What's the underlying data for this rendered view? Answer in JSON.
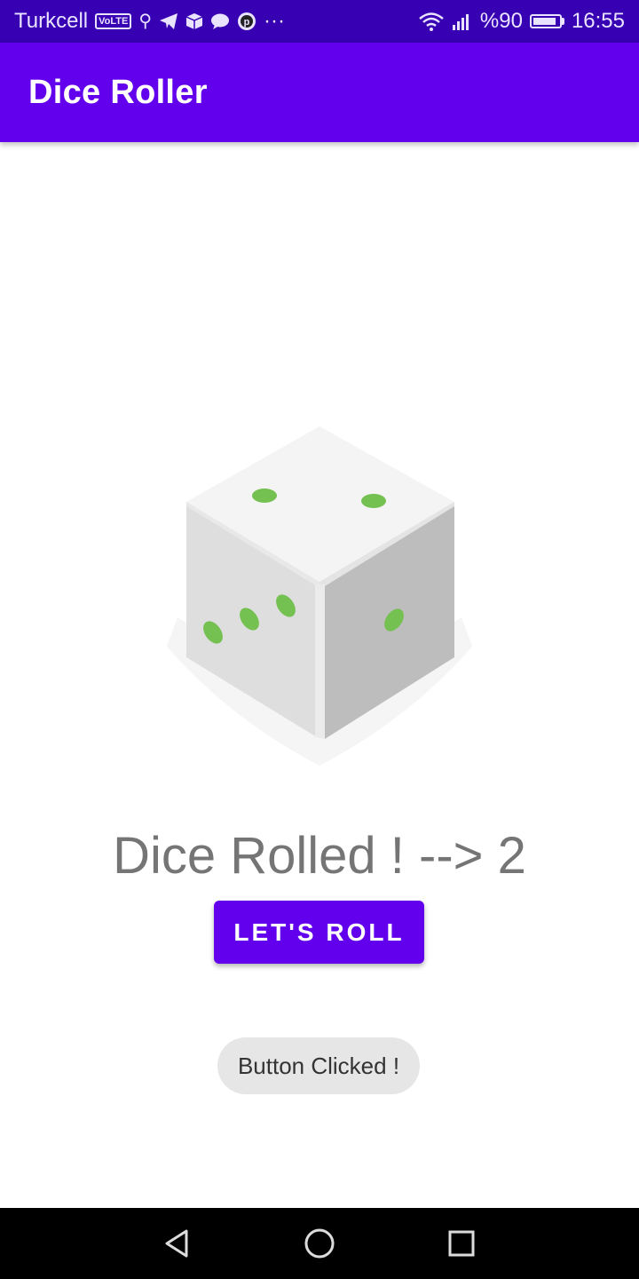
{
  "status_bar": {
    "carrier": "Turkcell",
    "volte": "VoLTE",
    "notification_icons": [
      "usb-icon",
      "telegram-icon",
      "box-icon",
      "chat-icon",
      "p-icon"
    ],
    "more": "···",
    "battery_text": "%90",
    "battery_level": 0.9,
    "time": "16:55"
  },
  "app_bar": {
    "title": "Dice Roller",
    "color": "#6200ee"
  },
  "main": {
    "dice_icon": "dice-icon",
    "result_text": "Dice Rolled ! --> 2",
    "roll_button_label": "LET'S ROLL"
  },
  "toast": {
    "text": "Button Clicked !"
  },
  "nav_bar": {
    "icons": [
      "back-icon",
      "home-icon",
      "recents-icon"
    ]
  },
  "colors": {
    "primary": "#6200ee",
    "primary_dark": "#3700b3",
    "pip_green": "#74c050"
  }
}
